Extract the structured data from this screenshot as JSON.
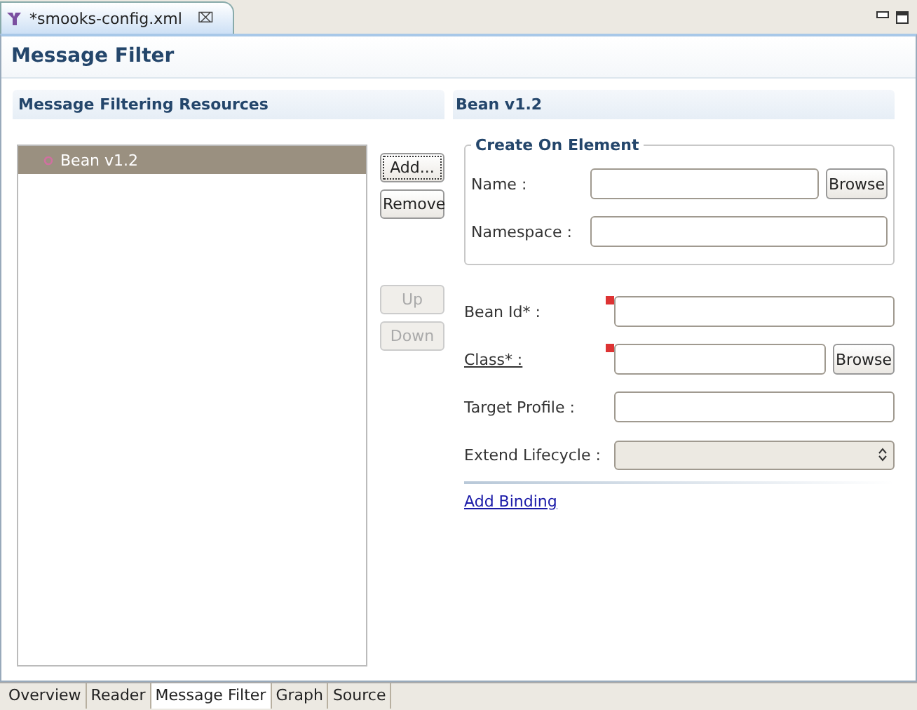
{
  "editor_tab": {
    "title": "*smooks-config.xml",
    "close": "⌧"
  },
  "page_title": "Message Filter",
  "resources": {
    "title": "Message Filtering Resources",
    "items": [
      {
        "label": "Bean v1.2",
        "selected": true
      }
    ],
    "buttons": [
      {
        "label": "Add...",
        "disabled": false,
        "focused": true
      },
      {
        "label": "Remove",
        "disabled": false,
        "focused": false
      },
      {
        "label": "Up",
        "disabled": true,
        "focused": false
      },
      {
        "label": "Down",
        "disabled": true,
        "focused": false
      }
    ]
  },
  "details": {
    "title": "Bean v1.2",
    "group": {
      "title": "Create On Element",
      "fields": [
        {
          "label": "Name :",
          "kind": "text",
          "browse": "Browse"
        },
        {
          "label": "Namespace :",
          "kind": "text"
        }
      ]
    },
    "fields": [
      {
        "label": "Bean Id* :",
        "kind": "text",
        "link": false,
        "error": true
      },
      {
        "label": "Class* :",
        "kind": "text",
        "link": true,
        "error": true,
        "browse": "Browse"
      },
      {
        "label": "Target Profile :",
        "kind": "text",
        "link": false,
        "error": false
      },
      {
        "label": "Extend Lifecycle :",
        "kind": "combo",
        "link": false,
        "error": false
      }
    ],
    "add_link": "Add Binding"
  },
  "page_tabs": [
    {
      "label": "Overview",
      "selected": false
    },
    {
      "label": "Reader",
      "selected": false
    },
    {
      "label": "Message Filter",
      "selected": true
    },
    {
      "label": "Graph",
      "selected": false
    },
    {
      "label": "Source",
      "selected": false
    }
  ]
}
